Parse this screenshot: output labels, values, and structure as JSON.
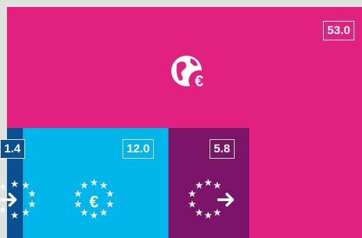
{
  "chart_data": {
    "type": "treemap",
    "items": [
      {
        "value": 53.0,
        "label": "53.0",
        "color": "#e2207f",
        "icon": "globe-euro-icon"
      },
      {
        "value": 12.0,
        "label": "12.0",
        "color": "#00b5ea",
        "icon": "euro-stars-circle-icon"
      },
      {
        "value": 5.8,
        "label": "5.8",
        "color": "#7b1369",
        "icon": "stars-circle-arrow-out-icon"
      },
      {
        "value": 1.4,
        "label": "1.4",
        "color": "#0a4f92",
        "icon": "stars-arrow-in-icon"
      }
    ]
  }
}
